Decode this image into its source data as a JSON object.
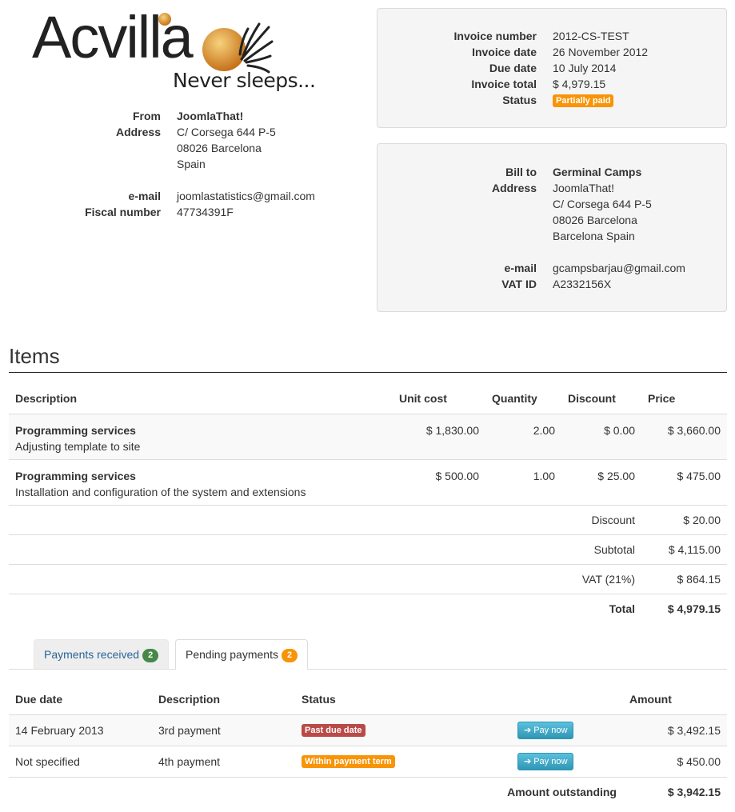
{
  "logo": {
    "name": "Acvilla",
    "tagline": "Never sleeps..."
  },
  "from": {
    "from_label": "From",
    "from_value": "JoomlaThat!",
    "address_label": "Address",
    "address_lines": [
      "C/ Corsega 644 P-5",
      "08026 Barcelona",
      "Spain"
    ],
    "email_label": "e-mail",
    "email_value": "joomlastatistics@gmail.com",
    "fiscal_label": "Fiscal number",
    "fiscal_value": "47734391F"
  },
  "invoice": {
    "number_label": "Invoice number",
    "number_value": "2012-CS-TEST",
    "date_label": "Invoice date",
    "date_value": "26 November 2012",
    "due_label": "Due date",
    "due_value": "10 July 2014",
    "total_label": "Invoice total",
    "total_value": "$ 4,979.15",
    "status_label": "Status",
    "status_value": "Partially paid"
  },
  "bill_to": {
    "bill_label": "Bill to",
    "bill_value": "Germinal Camps",
    "address_label": "Address",
    "address_lines": [
      "JoomlaThat!",
      "C/ Corsega 644 P-5",
      "08026 Barcelona",
      "Barcelona Spain"
    ],
    "email_label": "e-mail",
    "email_value": "gcampsbarjau@gmail.com",
    "vat_label": "VAT ID",
    "vat_value": "A2332156X"
  },
  "items": {
    "title": "Items",
    "headers": {
      "description": "Description",
      "unit_cost": "Unit cost",
      "quantity": "Quantity",
      "discount": "Discount",
      "price": "Price"
    },
    "rows": [
      {
        "name": "Programming services",
        "detail": "Adjusting template to site",
        "unit_cost": "$ 1,830.00",
        "quantity": "2.00",
        "discount": "$ 0.00",
        "price": "$ 3,660.00"
      },
      {
        "name": "Programming services",
        "detail": "Installation and configuration of the system and extensions",
        "unit_cost": "$ 500.00",
        "quantity": "1.00",
        "discount": "$ 25.00",
        "price": "$ 475.00"
      }
    ],
    "summary": [
      {
        "label": "Discount",
        "value": "$ 20.00"
      },
      {
        "label": "Subtotal",
        "value": "$ 4,115.00"
      },
      {
        "label": "VAT (21%)",
        "value": "$ 864.15"
      }
    ],
    "total_label": "Total",
    "total_value": "$ 4,979.15"
  },
  "tabs": [
    {
      "label": "Payments received",
      "count": "2"
    },
    {
      "label": "Pending payments",
      "count": "2"
    }
  ],
  "payments": {
    "headers": {
      "due_date": "Due date",
      "description": "Description",
      "status": "Status",
      "amount": "Amount"
    },
    "rows": [
      {
        "due_date": "14 February 2013",
        "description": "3rd payment",
        "status": "Past due date",
        "button": "Pay now",
        "amount": "$ 3,492.15"
      },
      {
        "due_date": "Not specified",
        "description": "4th payment",
        "status": "Within payment term",
        "button": "Pay now",
        "amount": "$ 450.00"
      }
    ],
    "outstanding_label": "Amount outstanding",
    "outstanding_value": "$ 3,942.15"
  },
  "colors": {
    "warning": "#f89406",
    "danger": "#b94a48",
    "success": "#468847",
    "info": "#2f96b4",
    "link": "#2a6496"
  }
}
